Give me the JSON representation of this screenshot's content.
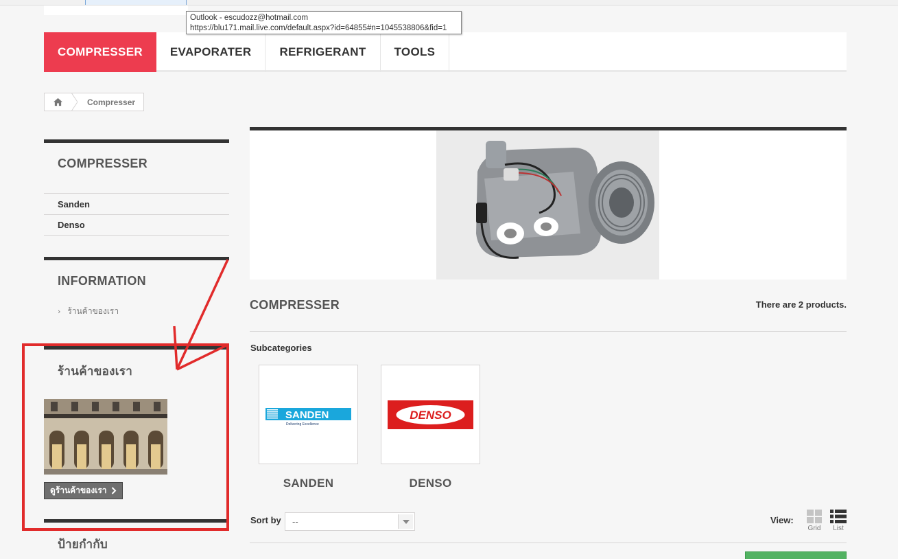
{
  "browser": {
    "tooltip_line1": "Outlook - escudozz@hotmail.com",
    "tooltip_line2": "https://blu171.mail.live.com/default.aspx?id=64855#n=1045538806&fid=1"
  },
  "menu": {
    "items": [
      {
        "label": "COMPRESSER"
      },
      {
        "label": "EVAPORATER"
      },
      {
        "label": "REFRIGERANT"
      },
      {
        "label": "TOOLS"
      }
    ]
  },
  "breadcrumb": {
    "home_icon": "home-icon",
    "current": "Compresser"
  },
  "sidebar": {
    "categories_title": "COMPRESSER",
    "categories": [
      {
        "label": "Sanden"
      },
      {
        "label": "Denso"
      }
    ],
    "information_title": "INFORMATION",
    "information_links": [
      {
        "label": "ร้านค้าของเรา"
      }
    ],
    "stores_title": "ร้านค้าของเรา",
    "stores_button": "ดูร้านค้าของเรา",
    "tags_title": "ป้ายกำกับ"
  },
  "main": {
    "category_heading": "COMPRESSER",
    "product_count": "There are 2 products.",
    "subcategories_title": "Subcategories",
    "subcategories": [
      {
        "name": "SANDEN",
        "logo_text": "SANDEN",
        "logo_tagline": "Delivering Excellence",
        "logo_color": "#1aa7dc"
      },
      {
        "name": "DENSO",
        "logo_text": "DENSO",
        "logo_color": "#dc1e1e"
      }
    ],
    "sort_label": "Sort by",
    "sort_value": "--",
    "view_label": "View:",
    "view_grid": "Grid",
    "view_list": "List"
  },
  "colors": {
    "accent": "#ed3c4f",
    "annotation": "#e12b2b"
  }
}
